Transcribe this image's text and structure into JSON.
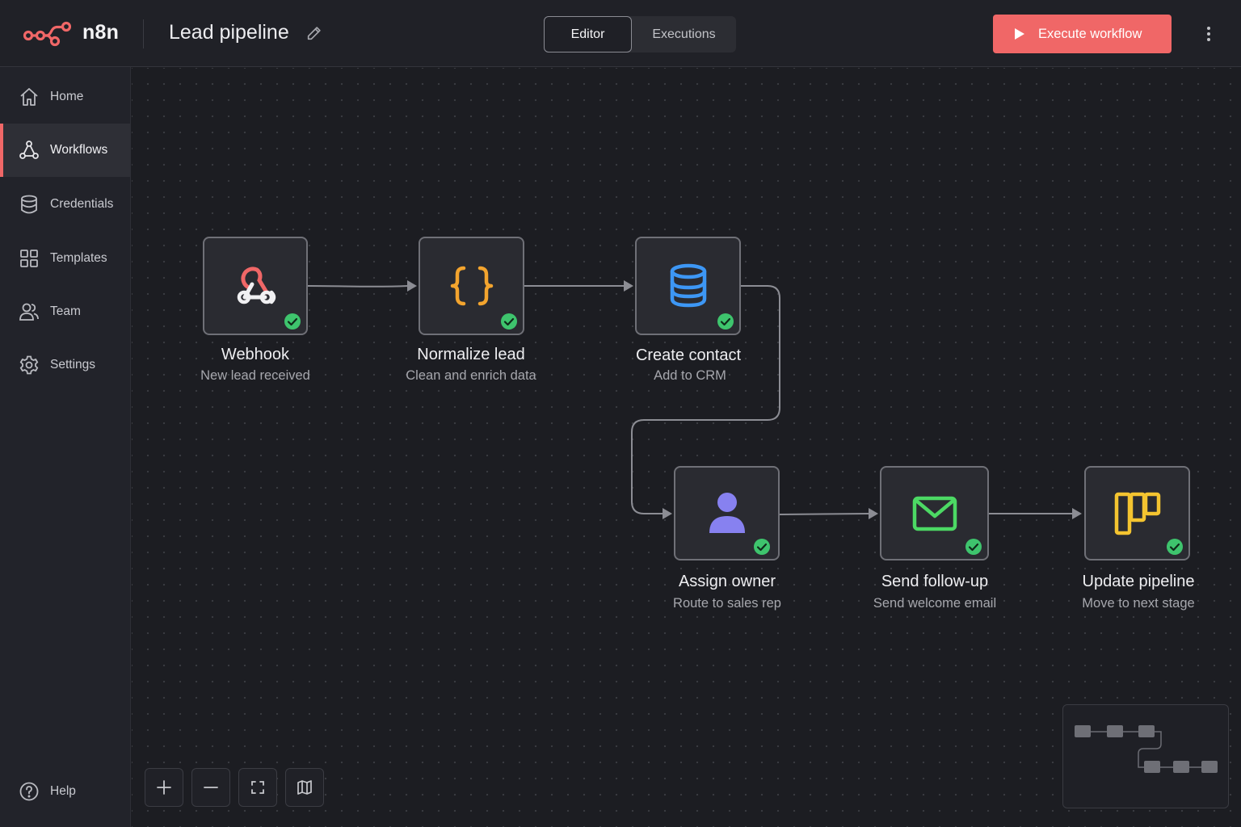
{
  "app": {
    "brand": "n8n",
    "workflow_title": "Lead pipeline"
  },
  "header": {
    "view_tabs": [
      {
        "label": "Editor",
        "active": true
      },
      {
        "label": "Executions",
        "active": false
      }
    ],
    "execute_label": "Execute workflow",
    "accent_color": "#f06767"
  },
  "sidebar": {
    "items": [
      {
        "label": "Home",
        "icon": "home-icon"
      },
      {
        "label": "Workflows",
        "icon": "workflow-icon",
        "active": true
      },
      {
        "label": "Credentials",
        "icon": "database-icon"
      },
      {
        "label": "Templates",
        "icon": "grid-icon"
      },
      {
        "label": "Team",
        "icon": "users-icon"
      },
      {
        "label": "Settings",
        "icon": "gear-icon"
      }
    ],
    "help_label": "Help"
  },
  "nodes": [
    {
      "title": "Webhook",
      "subtitle": "New lead received",
      "icon": "webhook-icon",
      "status": "success"
    },
    {
      "title": "Normalize lead",
      "subtitle": "Clean and enrich data",
      "icon": "code-braces-icon",
      "status": "success"
    },
    {
      "title": "Create contact",
      "subtitle": "Add to CRM",
      "icon": "database-icon",
      "status": "success"
    },
    {
      "title": "Assign owner",
      "subtitle": "Route to sales rep",
      "icon": "user-icon",
      "status": "success"
    },
    {
      "title": "Send follow-up",
      "subtitle": "Send welcome email",
      "icon": "mail-icon",
      "status": "success"
    },
    {
      "title": "Update pipeline",
      "subtitle": "Move to next stage",
      "icon": "kanban-icon",
      "status": "success"
    }
  ],
  "canvas_controls": [
    "zoom-in-icon",
    "zoom-out-icon",
    "fit-view-icon",
    "minimap-toggle-icon"
  ],
  "status_colors": {
    "success": "#3ec46d"
  }
}
